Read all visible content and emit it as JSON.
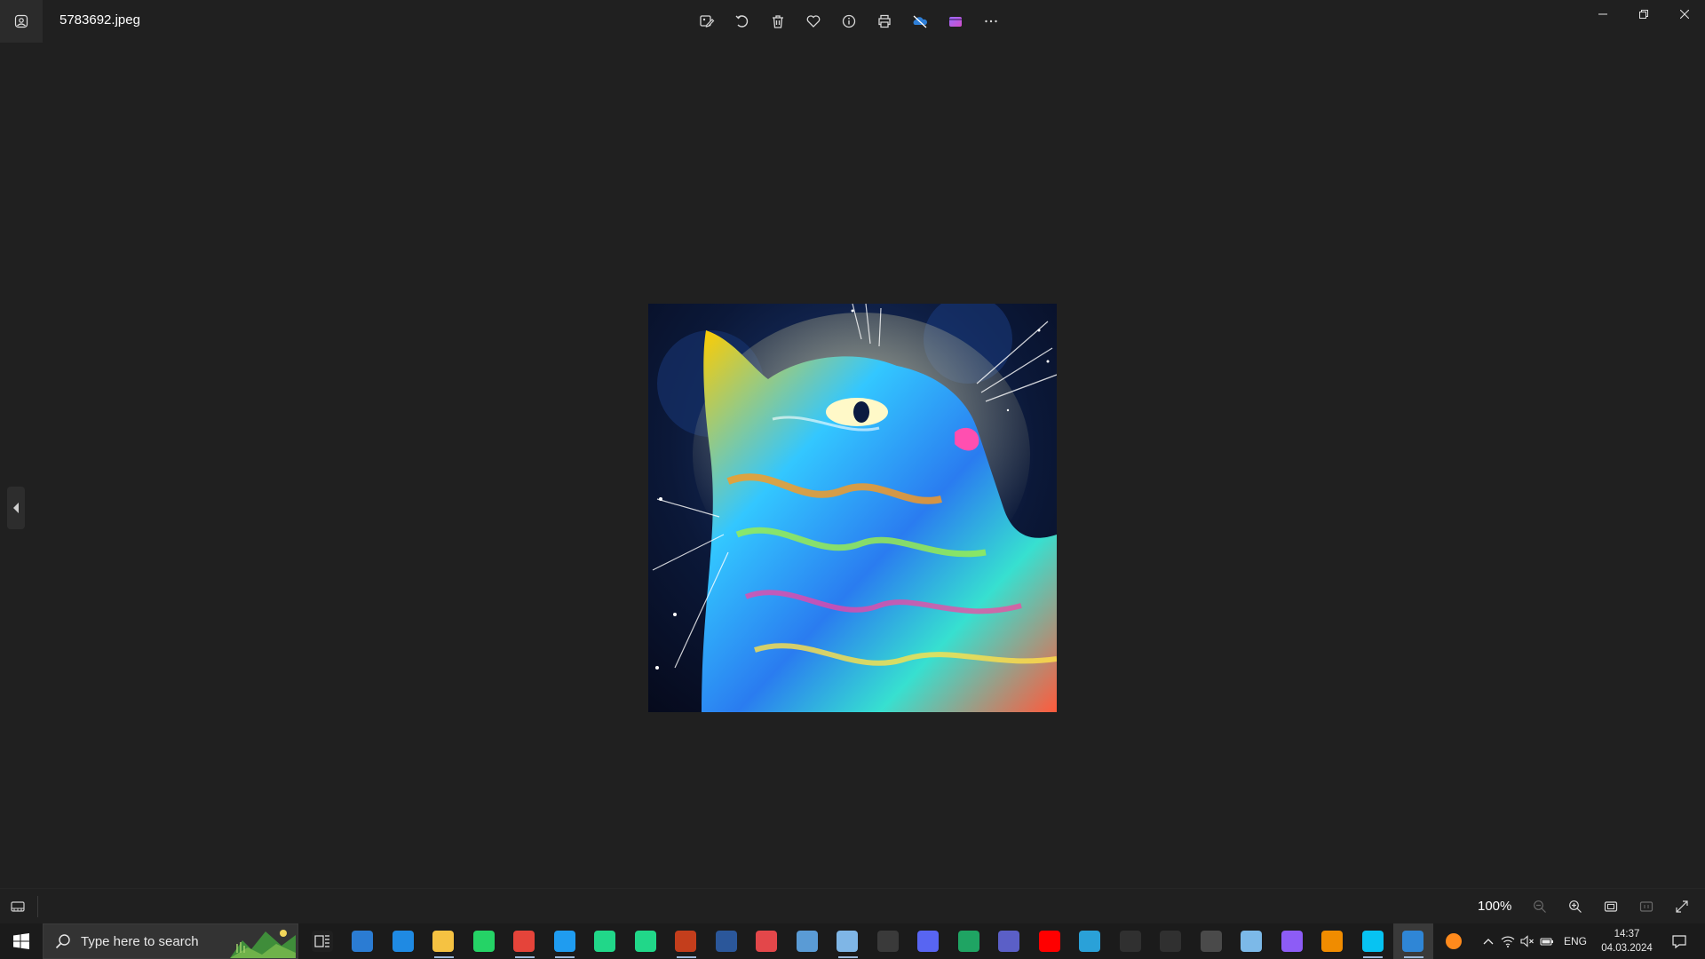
{
  "window": {
    "file_name": "5783692.jpeg",
    "controls": [
      "minimize-icon",
      "restore-icon",
      "close-icon"
    ]
  },
  "toolbar": {
    "items": [
      {
        "name": "edit-image-icon",
        "label": "Edit image"
      },
      {
        "name": "rotate-icon",
        "label": "Rotate"
      },
      {
        "name": "delete-icon",
        "label": "Delete"
      },
      {
        "name": "favorite-icon",
        "label": "Favorite"
      },
      {
        "name": "file-info-icon",
        "label": "File information"
      },
      {
        "name": "print-icon",
        "label": "Print"
      },
      {
        "name": "onedrive-offline-icon",
        "label": "OneDrive"
      },
      {
        "name": "clipchamp-icon",
        "label": "Clipchamp"
      },
      {
        "name": "more-options-icon",
        "label": "See more"
      }
    ]
  },
  "viewer": {
    "image_alt": "psychedelic rainbow cat looking up against starry night sky",
    "prev_icon": "chevron-left-icon"
  },
  "statusbar": {
    "zoom_level": "100%",
    "tools": [
      "zoom-out-icon",
      "zoom-in-icon",
      "fit-to-window-icon",
      "actual-size-icon",
      "full-screen-icon"
    ]
  },
  "taskbar": {
    "search_placeholder": "Type here to search",
    "apps": [
      {
        "name": "task-view-icon",
        "color": "#202020",
        "running": false
      },
      {
        "name": "outlook-news-icon",
        "color": "#2b7cd3",
        "running": false
      },
      {
        "name": "mail-icon",
        "color": "#1f8ae3",
        "running": false
      },
      {
        "name": "file-explorer-icon",
        "color": "#f5c242",
        "running": true
      },
      {
        "name": "whatsapp-icon",
        "color": "#25d366",
        "running": false
      },
      {
        "name": "chrome-icon",
        "color": "#e5443a",
        "running": true
      },
      {
        "name": "vscode-icon",
        "color": "#1f9cf0",
        "running": true
      },
      {
        "name": "clion-icon",
        "color": "#21d789",
        "running": false
      },
      {
        "name": "pycharm-icon",
        "color": "#21d789",
        "running": false
      },
      {
        "name": "powerpoint-icon",
        "color": "#c43e1c",
        "running": true
      },
      {
        "name": "word-icon",
        "color": "#2b579a",
        "running": false
      },
      {
        "name": "paint-3d-icon",
        "color": "#e3474a",
        "running": false
      },
      {
        "name": "remote-desktop-icon",
        "color": "#5a9bd5",
        "running": false
      },
      {
        "name": "notepad-icon",
        "color": "#7fb6e6",
        "running": true
      },
      {
        "name": "obs-icon",
        "color": "#3a3a3a",
        "running": false
      },
      {
        "name": "discord-icon",
        "color": "#5865f2",
        "running": false
      },
      {
        "name": "google-drive-icon",
        "color": "#1fa463",
        "running": false
      },
      {
        "name": "teams-new-icon",
        "color": "#5b5fc7",
        "running": false
      },
      {
        "name": "youtube-icon",
        "color": "#ff0000",
        "running": false
      },
      {
        "name": "browser-globe-icon",
        "color": "#2aa1d8",
        "running": false
      },
      {
        "name": "steelseries-icon",
        "color": "#303030",
        "running": false
      },
      {
        "name": "settings-gear-icon",
        "color": "#303030",
        "running": false
      },
      {
        "name": "calculator-icon",
        "color": "#4a4a4a",
        "running": false
      },
      {
        "name": "paint-palette-icon",
        "color": "#7cb9e8",
        "running": false
      },
      {
        "name": "network-star-icon",
        "color": "#8d5cf6",
        "running": false
      },
      {
        "name": "virtualbox-icon",
        "color": "#f08c00",
        "running": false
      },
      {
        "name": "webstorm-icon",
        "color": "#07c3f2",
        "running": true
      },
      {
        "name": "photos-icon",
        "color": "#2f86d6",
        "running": true,
        "active": true
      },
      {
        "name": "orange-circle-icon",
        "color": "#ff8a1c",
        "running": false
      }
    ],
    "tray": {
      "icons": [
        "show-hidden-icon",
        "wifi-icon",
        "speaker-muted-icon",
        "battery-icon"
      ],
      "language": "ENG",
      "time": "14:37",
      "date": "04.03.2024"
    }
  }
}
